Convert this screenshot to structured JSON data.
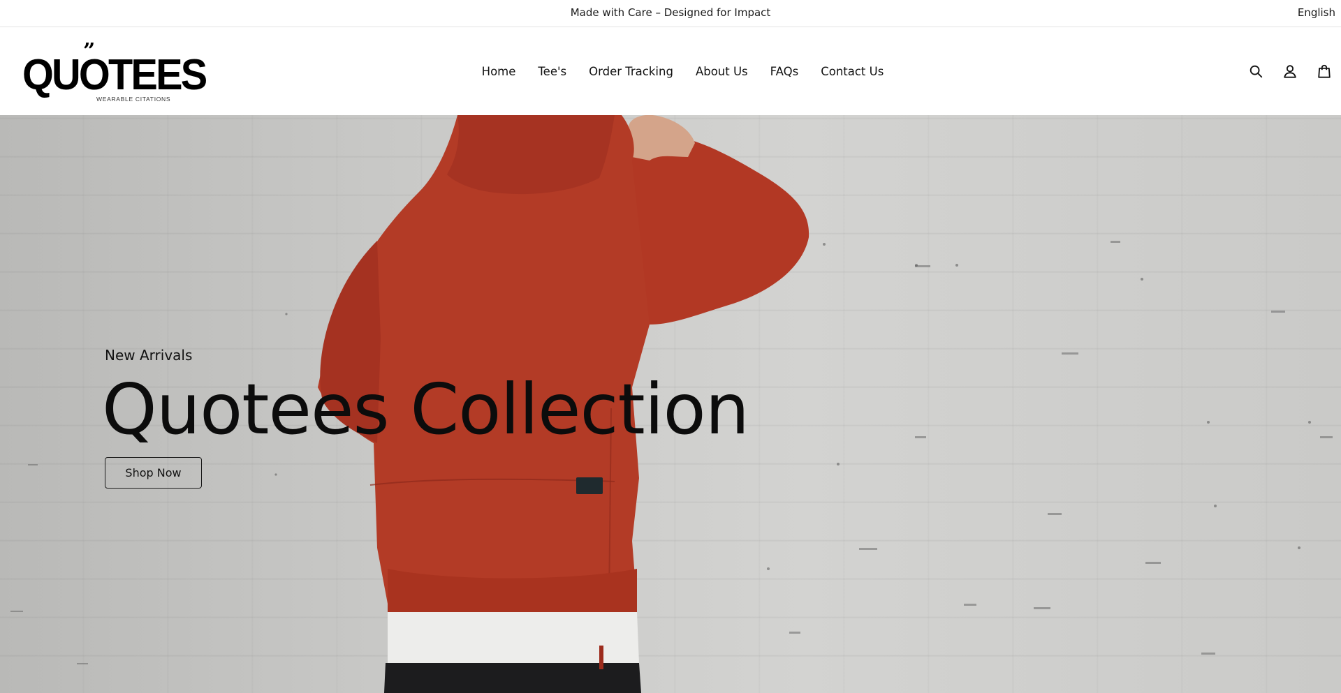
{
  "announcement": {
    "text": "Made with Care – Designed for Impact",
    "language": "English"
  },
  "brand": {
    "name": "QUOTEES",
    "quote_mark": "”",
    "tagline": "WEARABLE CITATIONS"
  },
  "nav": {
    "items": [
      {
        "label": "Home"
      },
      {
        "label": "Tee's"
      },
      {
        "label": "Order Tracking"
      },
      {
        "label": "About Us"
      },
      {
        "label": "FAQs"
      },
      {
        "label": "Contact Us"
      }
    ]
  },
  "header_icons": [
    "search-icon",
    "account-icon",
    "cart-icon"
  ],
  "hero": {
    "eyebrow": "New Arrivals",
    "title": "Quotees Collection",
    "button_label": "Shop Now",
    "image_description_colors": {
      "hoodie": "#b23a26",
      "wall": "#c9c9c7"
    }
  }
}
